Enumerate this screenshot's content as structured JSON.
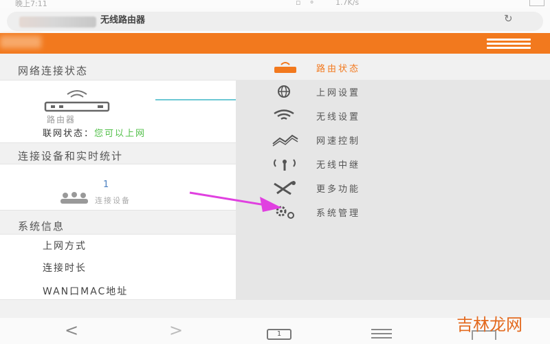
{
  "status_bar": {
    "time": "晚上7:11",
    "speed": "1.7K/s"
  },
  "browser": {
    "page_title": "无线路由器",
    "refresh_icon": "refresh-icon"
  },
  "header": {
    "menu_icon": "hamburger-menu-icon",
    "accent_color": "#f2791e"
  },
  "left": {
    "network_section": {
      "title": "网络连接状态",
      "router_label": "路由器",
      "status_label": "联网状态：",
      "status_value": "您可以上网"
    },
    "devices_section": {
      "title": "连接设备和实时统计",
      "count": "1",
      "label": "连接设备"
    },
    "system_section": {
      "title": "系统信息",
      "rows": [
        "上网方式",
        "连接时长",
        "WAN口MAC地址"
      ]
    }
  },
  "menu": {
    "items": [
      {
        "label": "路由状态",
        "icon": "router-icon",
        "active": true
      },
      {
        "label": "上网设置",
        "icon": "globe-icon"
      },
      {
        "label": "无线设置",
        "icon": "wifi-icon"
      },
      {
        "label": "网速控制",
        "icon": "speed-wave-icon"
      },
      {
        "label": "无线中继",
        "icon": "antenna-icon"
      },
      {
        "label": "更多功能",
        "icon": "tools-icon"
      },
      {
        "label": "系统管理",
        "icon": "gear-icon"
      }
    ]
  },
  "annotation": {
    "arrow_color": "#e040e0"
  },
  "bottom_nav": {
    "back": "<",
    "forward": ">",
    "tabs_count": "1"
  },
  "watermark": {
    "text": "吉林龙网"
  }
}
